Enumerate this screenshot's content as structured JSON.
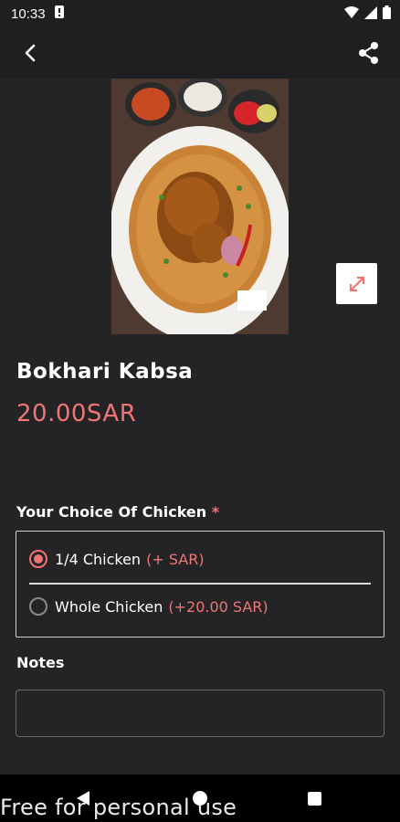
{
  "status_bar": {
    "time": "10:33",
    "icons": [
      "notification-icon",
      "wifi-icon",
      "signal-icon",
      "battery-icon"
    ]
  },
  "app_bar": {
    "back_icon": "arrow-left-icon",
    "share_icon": "share-icon"
  },
  "product": {
    "image_alt_icon": "food-photo",
    "expand_icon": "expand-icon",
    "name": "Bokhari Kabsa",
    "price": "20.00SAR"
  },
  "choice": {
    "label": "Your Choice Of Chicken",
    "required_mark": "*",
    "options": [
      {
        "label": "1/4 Chicken",
        "extra": "(+ SAR)",
        "selected": true
      },
      {
        "label": "Whole Chicken",
        "extra": "(+20.00 SAR)",
        "selected": false
      }
    ]
  },
  "notes": {
    "label": "Notes",
    "value": "",
    "placeholder": ""
  },
  "watermark": "Free for personal use",
  "colors": {
    "accent": "#f07575",
    "background": "#242427",
    "bar": "#1f1f22"
  }
}
